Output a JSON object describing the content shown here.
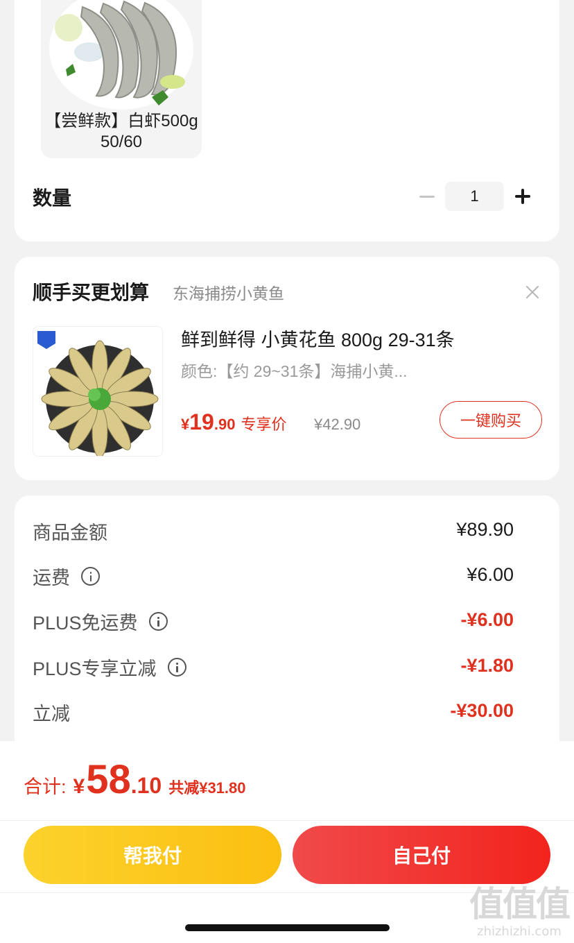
{
  "variant": {
    "label": "【尝鲜款】白虾500g 50/60"
  },
  "quantity": {
    "label": "数量",
    "value": "1"
  },
  "recommendation": {
    "title": "顺手买更划算",
    "subtitle": "东海捕捞小黄鱼",
    "product_name": "鲜到鲜得 小黄花鱼 800g 29-31条",
    "spec": "颜色:【约 29~31条】海捕小黄...",
    "price_symbol": "¥",
    "price_int": "19",
    "price_dec": ".90",
    "price_tag": "专享价",
    "original_price": "¥42.90",
    "buy_label": "一键购买"
  },
  "summary": {
    "rows": [
      {
        "label": "商品金额",
        "value": "¥89.90",
        "info": false,
        "highlight": false
      },
      {
        "label": "运费",
        "value": "¥6.00",
        "info": true,
        "highlight": false
      },
      {
        "label": "PLUS免运费",
        "value": "-¥6.00",
        "info": true,
        "highlight": true
      },
      {
        "label": "PLUS专享立减",
        "value": "-¥1.80",
        "info": true,
        "highlight": true
      },
      {
        "label": "立减",
        "value": "-¥30.00",
        "info": false,
        "highlight": true
      }
    ]
  },
  "footer": {
    "total_label": "合计:",
    "total_symbol": "¥",
    "total_int": "58",
    "total_dec": ".10",
    "total_saved": "共减¥31.80",
    "help_pay_label": "帮我付",
    "self_pay_label": "自己付"
  },
  "watermark": {
    "glyphs": "值值值",
    "site": "zhizhizhi.com"
  },
  "colors": {
    "accent_red": "#e0301e",
    "help_pay_yellow": "#fbc51e",
    "self_pay_red": "#f2342d"
  }
}
